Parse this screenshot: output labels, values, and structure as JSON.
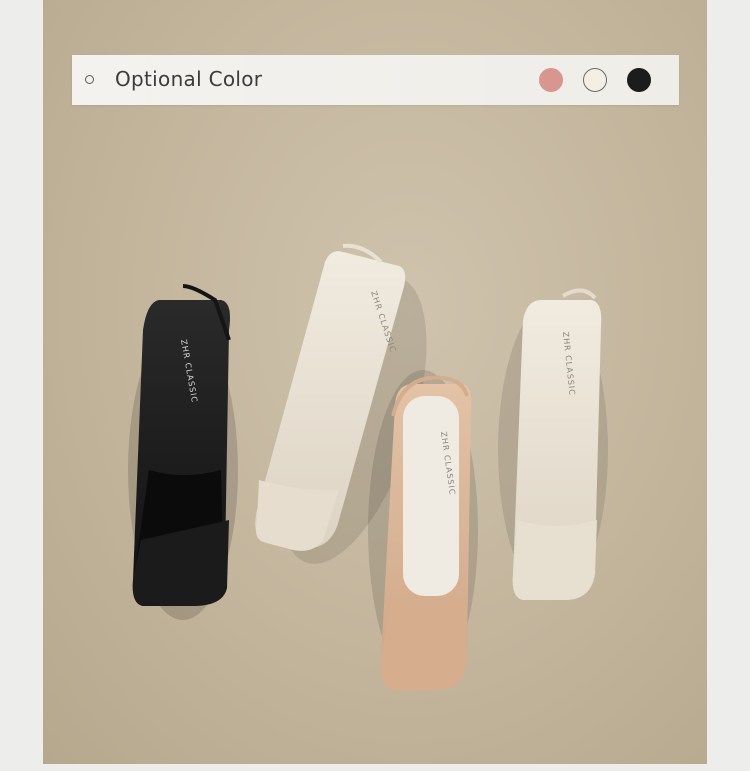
{
  "banner": {
    "title": "Optional Color",
    "swatches": [
      {
        "name": "pink",
        "color": "#d99590"
      },
      {
        "name": "cream",
        "color": "#f4efe5"
      },
      {
        "name": "black",
        "color": "#1c1c1c"
      }
    ]
  },
  "products": [
    {
      "color": "black",
      "insole_text": "ZHR CLASSIC"
    },
    {
      "color": "cream",
      "insole_text": "ZHR CLASSIC"
    },
    {
      "color": "nude",
      "insole_text": "ZHR CLASSIC"
    },
    {
      "color": "cream",
      "insole_text": "ZHR CLASSIC"
    }
  ]
}
